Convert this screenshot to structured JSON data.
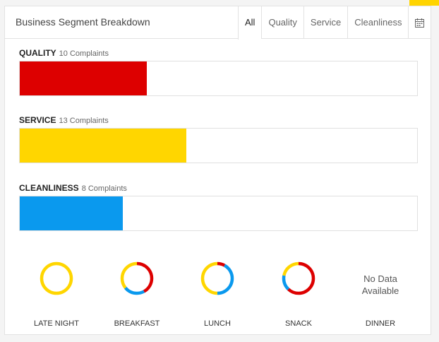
{
  "header": {
    "title": "Business Segment Breakdown",
    "tabs": [
      {
        "label": "All",
        "active": true
      },
      {
        "label": "Quality",
        "active": false
      },
      {
        "label": "Service",
        "active": false
      },
      {
        "label": "Cleanliness",
        "active": false
      }
    ],
    "calendar_icon": "calendar-icon"
  },
  "segments": [
    {
      "label": "QUALITY",
      "count": "10 Complaints",
      "fill_fraction": 0.32,
      "color": "#dd0000"
    },
    {
      "label": "SERVICE",
      "count": "13 Complaints",
      "fill_fraction": 0.42,
      "color": "#ffd600"
    },
    {
      "label": "CLEANLINESS",
      "count": "8 Complaints",
      "fill_fraction": 0.26,
      "color": "#0a99ee"
    }
  ],
  "donuts": [
    {
      "label": "LATE NIGHT",
      "slices": [
        {
          "color": "#ffd600",
          "fraction": 1.0
        }
      ]
    },
    {
      "label": "BREAKFAST",
      "slices": [
        {
          "color": "#dd0000",
          "fraction": 0.42
        },
        {
          "color": "#0a99ee",
          "fraction": 0.22
        },
        {
          "color": "#ffd600",
          "fraction": 0.36
        }
      ]
    },
    {
      "label": "LUNCH",
      "slices": [
        {
          "color": "#dd0000",
          "fraction": 0.08
        },
        {
          "color": "#0a99ee",
          "fraction": 0.42
        },
        {
          "color": "#ffd600",
          "fraction": 0.5
        }
      ]
    },
    {
      "label": "SNACK",
      "slices": [
        {
          "color": "#dd0000",
          "fraction": 0.62
        },
        {
          "color": "#0a99ee",
          "fraction": 0.16
        },
        {
          "color": "#ffd600",
          "fraction": 0.22
        }
      ]
    },
    {
      "label": "DINNER",
      "nodata_line1": "No Data",
      "nodata_line2": "Available"
    }
  ],
  "colors": {
    "accent": "#ffd400",
    "quality": "#dd0000",
    "service": "#ffd600",
    "cleanliness": "#0a99ee"
  }
}
